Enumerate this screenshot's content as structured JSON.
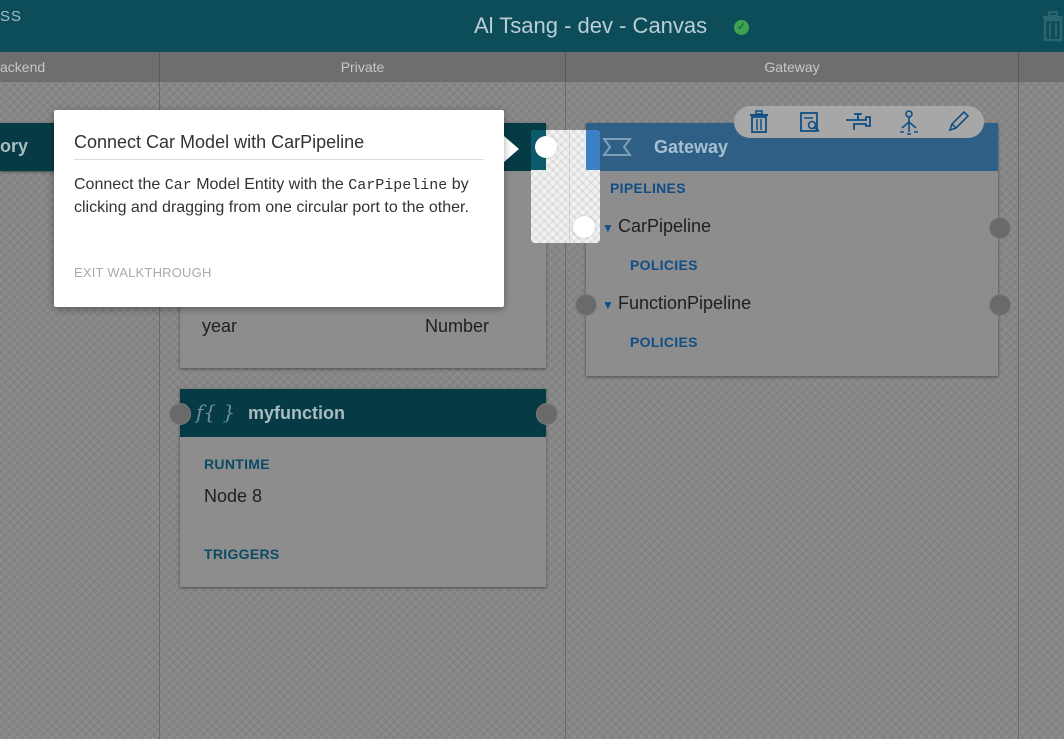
{
  "topbar": {
    "brand": "SS",
    "title": "Al Tsang  -  dev  -  Canvas",
    "status_icon": "check-circle-icon",
    "status_color": "#3fa34d",
    "delete_icon": "trash-icon"
  },
  "columns": [
    "ackend",
    "Private",
    "Gateway"
  ],
  "left_card": {
    "title": "ory"
  },
  "entity_card": {
    "field_name": "year",
    "field_type": "Number"
  },
  "function_card": {
    "icon_text": "f{ }",
    "name": "myfunction",
    "runtime_label": "RUNTIME",
    "runtime_value": "Node 8",
    "triggers_label": "TRIGGERS"
  },
  "gateway_card": {
    "title": "Gateway",
    "pipelines_label": "PIPELINES",
    "pipelines": [
      {
        "name": "CarPipeline",
        "policies_label": "POLICIES"
      },
      {
        "name": "FunctionPipeline",
        "policies_label": "POLICIES"
      }
    ]
  },
  "gateway_toolbar": [
    "trash-icon",
    "document-search-icon",
    "faucet-icon",
    "hierarchy-icon",
    "pencil-icon"
  ],
  "walkthrough": {
    "title": "Connect Car Model with CarPipeline",
    "body_1": "Connect the ",
    "code_1": "Car",
    "body_2": " Model Entity with the ",
    "code_2": "CarPipeline",
    "body_3": " by clicking and dragging from one circular port to the other.",
    "exit": "EXIT WALKTHROUGH"
  },
  "colors": {
    "header_bg": "#0d4d5a",
    "card_header": "#063a44",
    "gateway_header": "#3b7fc4",
    "label_blue": "#0b4b63"
  }
}
